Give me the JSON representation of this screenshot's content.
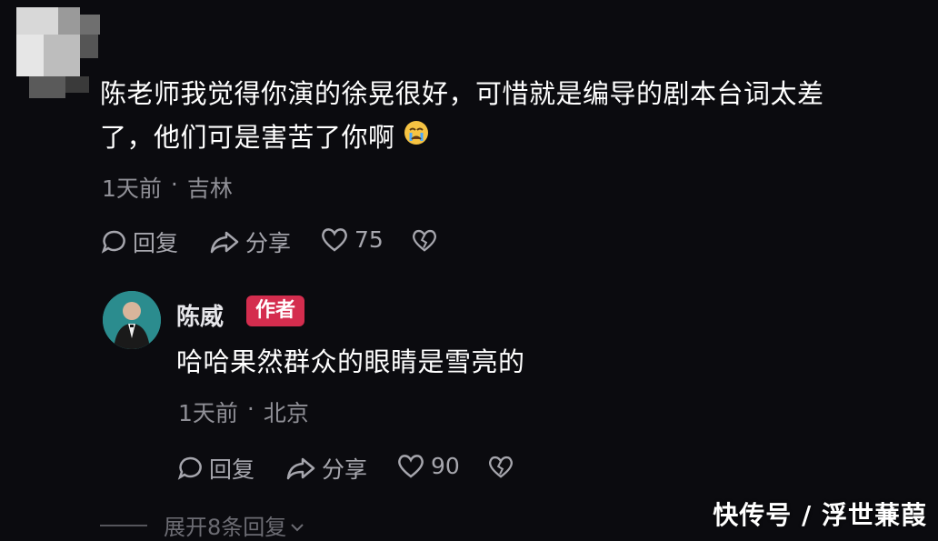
{
  "comment1": {
    "text_line1": "陈老师我觉得你演的徐晃很好，可惜就是编导的剧本台词太差",
    "text_line2": "了，他们可是害苦了你啊",
    "emoji": "crying-face-icon",
    "time": "1天前",
    "sep": "·",
    "location": "吉林",
    "reply_label": "回复",
    "share_label": "分享",
    "like_count": "75"
  },
  "comment2": {
    "author": "陈威",
    "author_badge": "作者",
    "text": "哈哈果然群众的眼睛是雪亮的",
    "time": "1天前",
    "sep": "·",
    "location": "北京",
    "reply_label": "回复",
    "share_label": "分享",
    "like_count": "90"
  },
  "expand_replies": "展开8条回复",
  "watermark": "快传号 / 浮世蒹葭",
  "colors": {
    "background": "#0b0b0f",
    "badge": "#d42d4e",
    "meta_text": "#8f8f96"
  }
}
